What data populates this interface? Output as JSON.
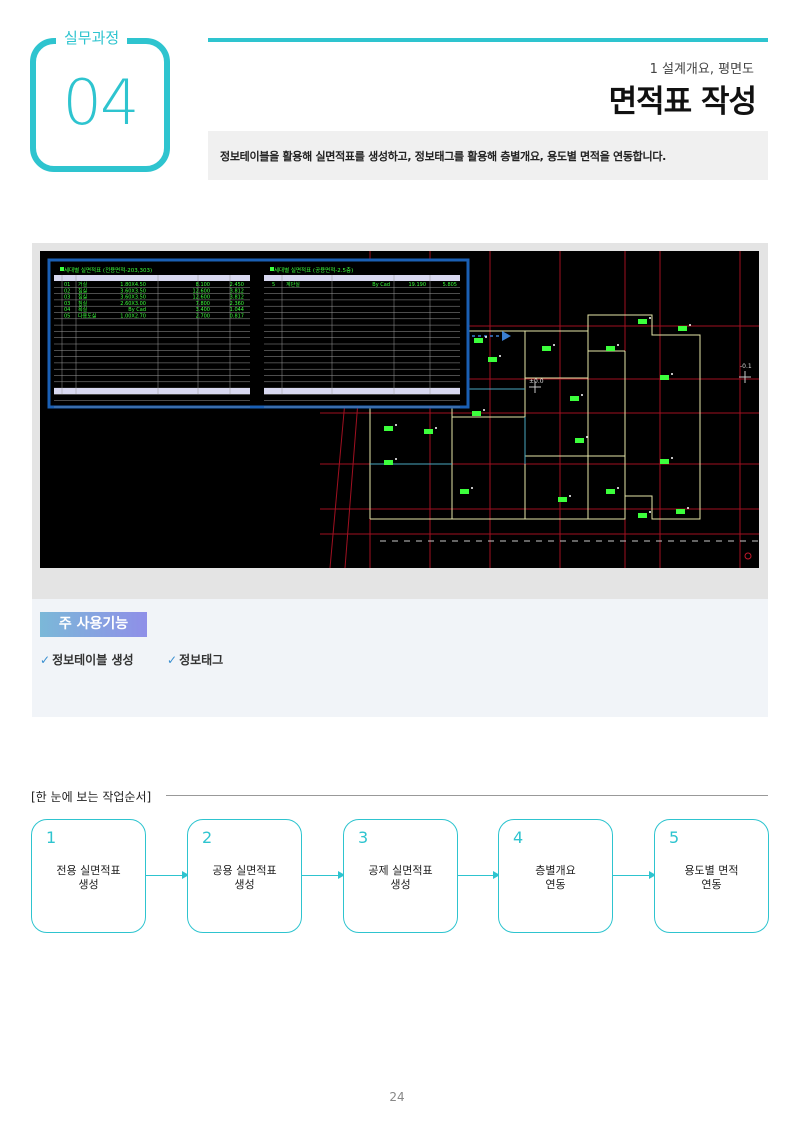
{
  "header": {
    "badge_label": "실무과정",
    "badge_number": "04",
    "chapter_sub": "1 설계개요, 평면도",
    "title": "면적표 작성",
    "description": "정보테이블을 활용해 실면적표를 생성하고, 정보태그를 활용해 층별개요, 용도별 면적을 연동합니다."
  },
  "figure": {
    "left_table_title": "세대별 실면적표 (전용면적-203,303)",
    "right_table_title": "세대별 실면적표 (공용면적-2.5층)",
    "left_rows": [
      [
        "01",
        "거실",
        "1.80X4.50",
        "8.100",
        "2.450"
      ],
      [
        "02",
        "침실",
        "3.60X3.50",
        "12.600",
        "3.812"
      ],
      [
        "03",
        "침실",
        "3.60X3.50",
        "12.600",
        "3.812"
      ],
      [
        "03",
        "침실",
        "2.60X3.00",
        "7.800",
        "2.360"
      ],
      [
        "04",
        "욕실",
        "By Cad",
        "3.400",
        "1.044"
      ],
      [
        "05",
        "다용도실",
        "1.00X2.70",
        "2.700",
        "0.817"
      ]
    ],
    "right_rows": [
      [
        "5",
        "계단실",
        "By Cad",
        "19.190",
        "5.805"
      ]
    ],
    "coord_labels": [
      "±0.0",
      "-0.1"
    ]
  },
  "functions": {
    "title": "주 사용기능",
    "items": [
      "정보테이블 생성",
      "정보태그"
    ]
  },
  "process": {
    "heading": "[한 눈에 보는 작업순서]",
    "steps": [
      {
        "num": "1",
        "text": "전용 실면적표\n생성"
      },
      {
        "num": "2",
        "text": "공용 실면적표\n생성"
      },
      {
        "num": "3",
        "text": "공제 실면적표\n생성"
      },
      {
        "num": "4",
        "text": "층별개요\n연동"
      },
      {
        "num": "5",
        "text": "용도별 면적\n연동"
      }
    ]
  },
  "page_number": "24",
  "colors": {
    "accent": "#2ec4cf",
    "cad_green": "#3cff3c",
    "cad_red": "#c0182a",
    "cad_yellow": "#e8e8a0",
    "table_border": "#1a5fb4"
  }
}
